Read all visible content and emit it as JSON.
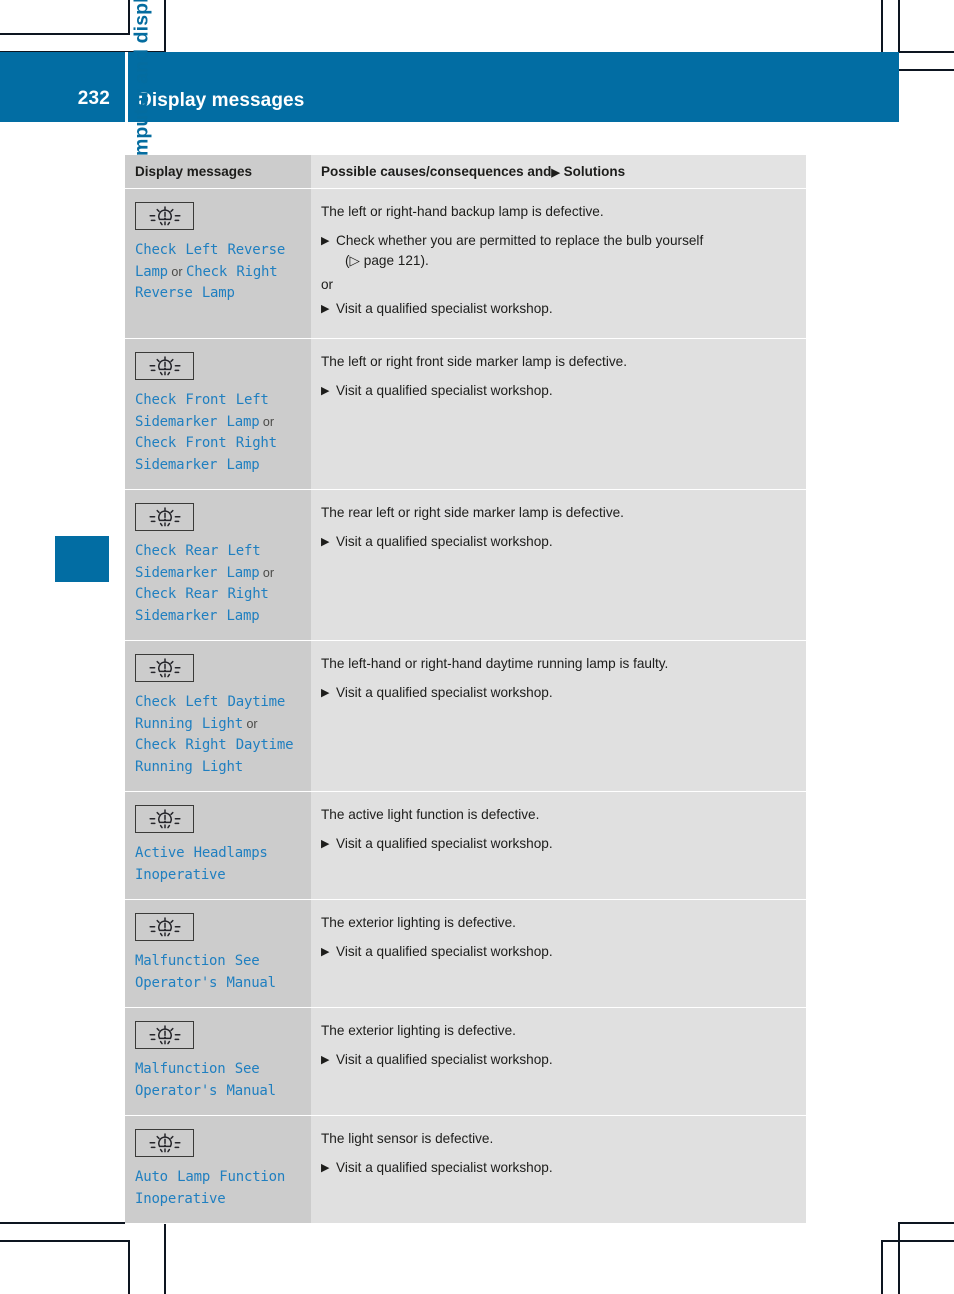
{
  "page": {
    "number": "232",
    "header_title": "Display messages",
    "chapter_label": "On-board computer and displays",
    "accent_color": "#026da3",
    "message_color": "#1f7fc0"
  },
  "table": {
    "headers": {
      "col1": "Display messages",
      "col2_prefix": "Possible causes/consequences and",
      "col2_arrow": "▶",
      "col2_suffix": "Solutions"
    },
    "rows": [
      {
        "icon": "lamp-indicator-icon",
        "message_parts": [
          {
            "type": "msg",
            "text": "Check Left Reverse Lamp"
          },
          {
            "type": "conj",
            "text": " or "
          },
          {
            "type": "msg",
            "text": "Check Right Reverse Lamp"
          }
        ],
        "cause": "The left or right-hand backup lamp is defective.",
        "solutions": [
          {
            "text": "Check whether you are permitted to replace the bulb yourself",
            "subline": "(▷ page 121)."
          }
        ],
        "or_label": "or",
        "solutions2": [
          {
            "text": "Visit a qualified specialist workshop."
          }
        ]
      },
      {
        "icon": "lamp-indicator-icon",
        "message_parts": [
          {
            "type": "msg",
            "text": "Check Front Left Sidemarker Lamp"
          },
          {
            "type": "conj",
            "text": " or "
          },
          {
            "type": "msg",
            "text": "Check Front Right Sidemarker Lamp"
          }
        ],
        "cause": "The left or right front side marker lamp is defective.",
        "solutions": [
          {
            "text": "Visit a qualified specialist workshop."
          }
        ]
      },
      {
        "icon": "lamp-indicator-icon",
        "message_parts": [
          {
            "type": "msg",
            "text": "Check Rear Left Sidemarker Lamp"
          },
          {
            "type": "conj",
            "text": " or "
          },
          {
            "type": "msg",
            "text": "Check Rear Right Sidemarker Lamp"
          }
        ],
        "cause": "The rear left or right side marker lamp is defective.",
        "solutions": [
          {
            "text": "Visit a qualified specialist workshop."
          }
        ]
      },
      {
        "icon": "lamp-indicator-icon",
        "message_parts": [
          {
            "type": "msg",
            "text": "Check Left Daytime Running Light"
          },
          {
            "type": "conj",
            "text": " or "
          },
          {
            "type": "msg",
            "text": "Check Right Daytime Running Light"
          }
        ],
        "cause": "The left-hand or right-hand daytime running lamp is faulty.",
        "solutions": [
          {
            "text": "Visit a qualified specialist workshop."
          }
        ]
      },
      {
        "icon": "lamp-indicator-icon",
        "message_parts": [
          {
            "type": "msg",
            "text": "Active Headlamps Inoperative"
          }
        ],
        "cause": "The active light function is defective.",
        "solutions": [
          {
            "text": "Visit a qualified specialist workshop."
          }
        ]
      },
      {
        "icon": "lamp-indicator-icon",
        "message_parts": [
          {
            "type": "msg",
            "text": "Malfunction See Operator's Manual"
          }
        ],
        "cause": "The exterior lighting is defective.",
        "solutions": [
          {
            "text": "Visit a qualified specialist workshop."
          }
        ]
      },
      {
        "icon": "lamp-indicator-icon",
        "message_parts": [
          {
            "type": "msg",
            "text": "Malfunction See Operator's Manual"
          }
        ],
        "cause": "The exterior lighting is defective.",
        "solutions": [
          {
            "text": "Visit a qualified specialist workshop."
          }
        ]
      },
      {
        "icon": "lamp-indicator-icon",
        "message_parts": [
          {
            "type": "msg",
            "text": "Auto Lamp Function Inoperative"
          }
        ],
        "cause": "The light sensor is defective.",
        "solutions": [
          {
            "text": "Visit a qualified specialist workshop."
          }
        ]
      }
    ]
  }
}
